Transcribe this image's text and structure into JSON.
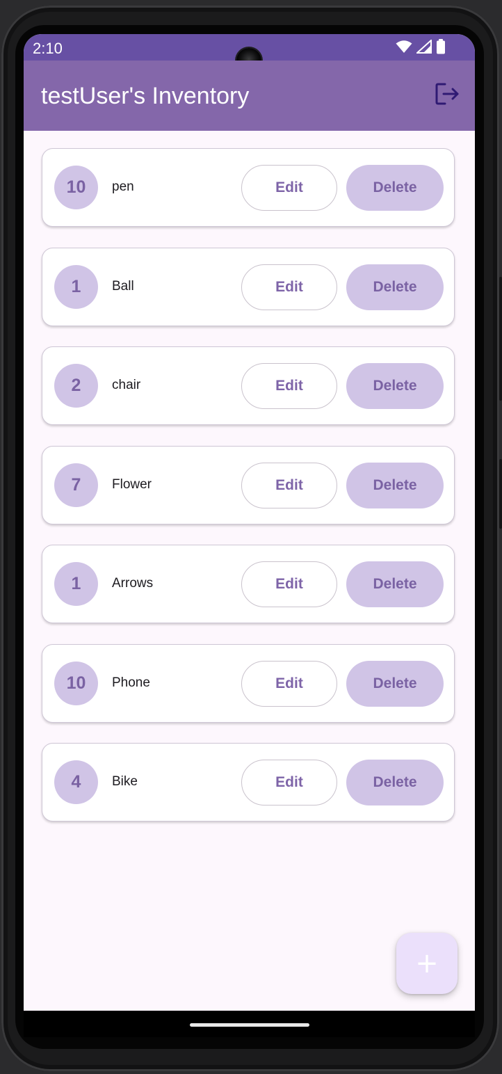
{
  "status_bar": {
    "time": "2:10",
    "icons": [
      "wifi-icon",
      "signal-icon",
      "battery-icon"
    ]
  },
  "app_bar": {
    "title": "testUser's Inventory",
    "logout_icon": "logout-icon"
  },
  "items": [
    {
      "quantity": "10",
      "name": "pen",
      "edit_label": "Edit",
      "delete_label": "Delete"
    },
    {
      "quantity": "1",
      "name": "Ball",
      "edit_label": "Edit",
      "delete_label": "Delete"
    },
    {
      "quantity": "2",
      "name": "chair",
      "edit_label": "Edit",
      "delete_label": "Delete"
    },
    {
      "quantity": "7",
      "name": "Flower",
      "edit_label": "Edit",
      "delete_label": "Delete"
    },
    {
      "quantity": "1",
      "name": "Arrows",
      "edit_label": "Edit",
      "delete_label": "Delete"
    },
    {
      "quantity": "10",
      "name": "Phone",
      "edit_label": "Edit",
      "delete_label": "Delete"
    },
    {
      "quantity": "4",
      "name": "Bike",
      "edit_label": "Edit",
      "delete_label": "Delete"
    }
  ],
  "fab": {
    "label": "+",
    "icon": "plus-icon"
  },
  "colors": {
    "status_bar": "#6750a4",
    "app_bar": "#8467aa",
    "background": "#fdf7fd",
    "accent": "#7e64a8",
    "badge": "#d0c4e6",
    "fab": "#ebe0fb"
  }
}
